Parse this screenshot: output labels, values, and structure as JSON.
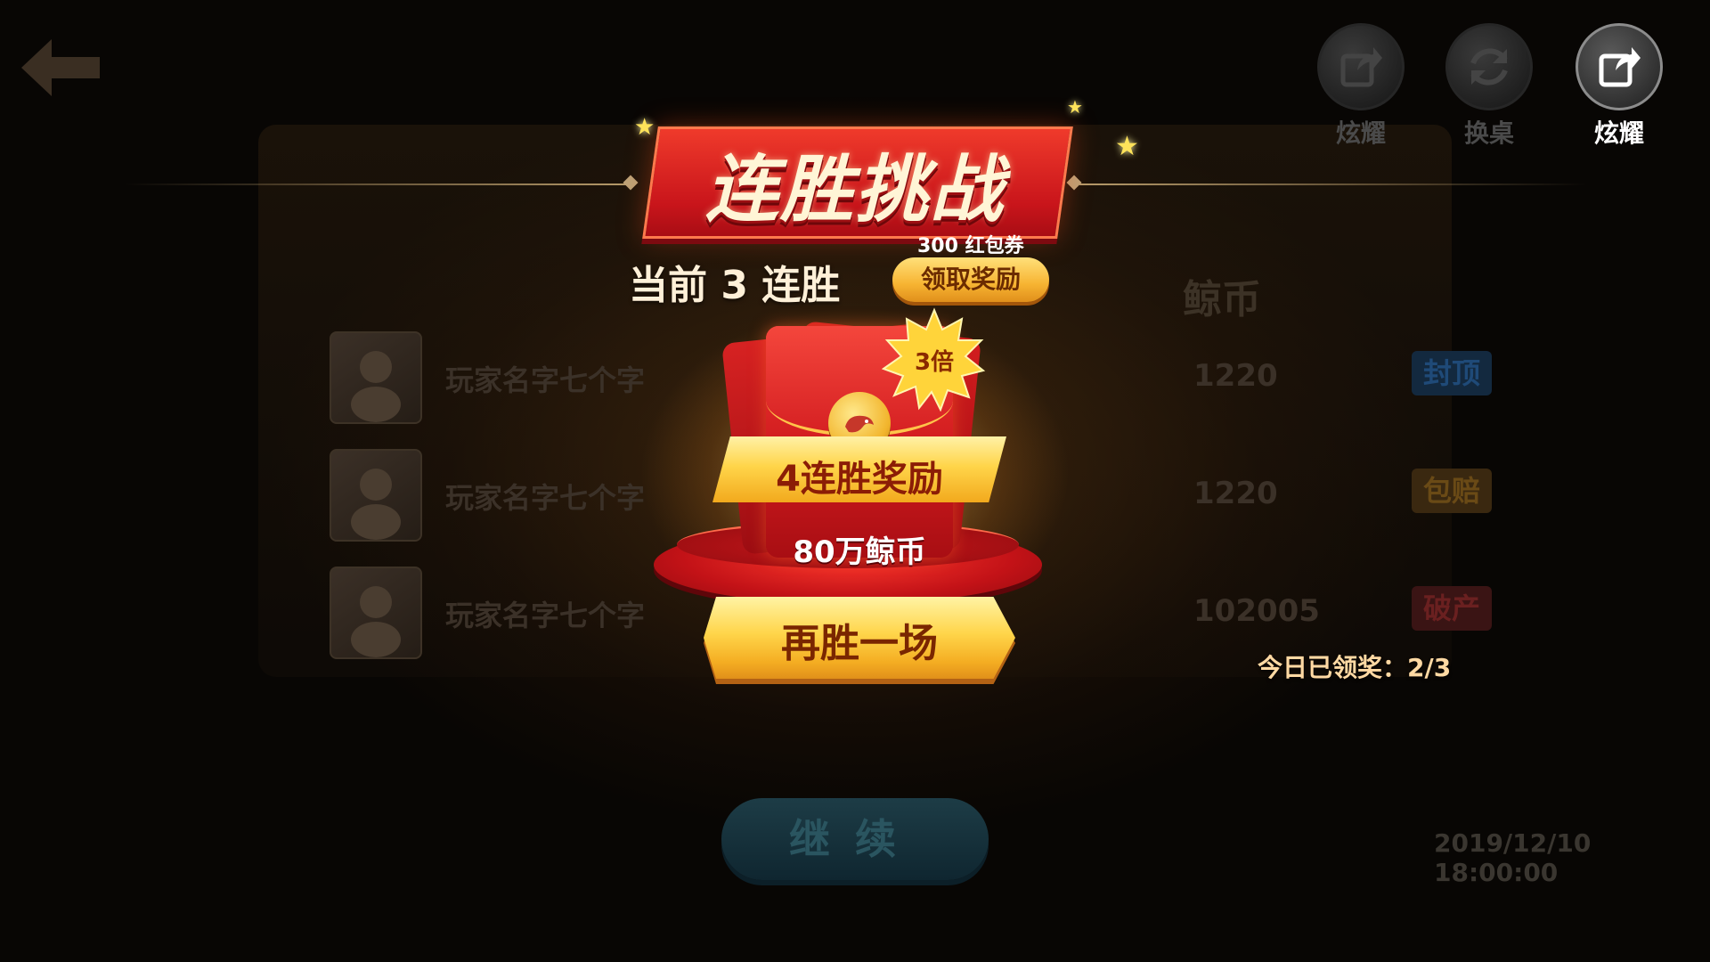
{
  "background": {
    "top_buttons": [
      {
        "label": "炫耀",
        "icon": "share-icon",
        "active": false
      },
      {
        "label": "换桌",
        "icon": "refresh-icon",
        "active": false
      },
      {
        "label": "炫耀",
        "icon": "share-icon",
        "active": true
      }
    ],
    "column_header": "鲸币",
    "rows": [
      {
        "name": "玩家名字七个字",
        "value": "1220",
        "tag": "封顶",
        "tag_color": "#2a6fbf"
      },
      {
        "name": "玩家名字七个字",
        "value": "1220",
        "tag": "包赔",
        "tag_color": "#d08a1c"
      },
      {
        "name": "玩家名字七个字",
        "value": "102005",
        "tag": "破产",
        "tag_color": "#c0282a"
      }
    ],
    "continue_label": "继续",
    "datetime": "2019/12/10  18:00:00"
  },
  "popup": {
    "title": "连胜挑战",
    "current_streak": "当前 3 连胜",
    "coupon_text": "300 红包券",
    "claim_button": "领取奖励",
    "multiplier_badge": "3倍",
    "reward_title": "4连胜奖励",
    "reward_amount": "80万鲸币",
    "win_again_button": "再胜一场",
    "daily_claimed": "今日已领奖：2/3"
  },
  "colors": {
    "title_red": "#d8191d",
    "gold": "#ffd54a",
    "ribbon_text": "#8b1d06"
  }
}
